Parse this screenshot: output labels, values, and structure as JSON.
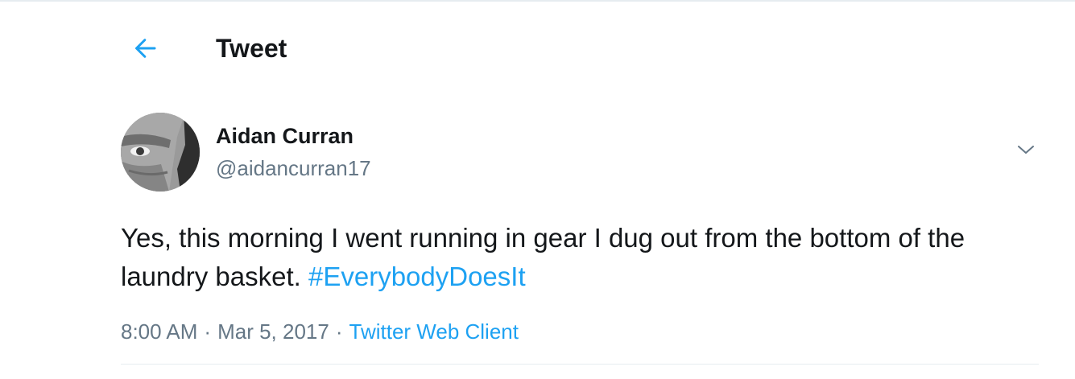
{
  "header": {
    "title": "Tweet",
    "back_icon": "arrow-left-icon"
  },
  "tweet": {
    "author_name": "Aidan Curran",
    "author_handle": "@aidancurran17",
    "avatar": "avatar-photo",
    "menu_icon": "chevron-down-icon",
    "text": "Yes, this morning I went running in gear I dug out from the bottom of the laundry basket.",
    "hashtag": "#EverybodyDoesIt",
    "time": "8:00 AM",
    "separator": "·",
    "date": "Mar 5, 2017",
    "source": "Twitter Web Client"
  },
  "colors": {
    "accent": "#1da1f2",
    "text_primary": "#14171a",
    "text_secondary": "#657786",
    "divider": "#e6ecf0"
  }
}
